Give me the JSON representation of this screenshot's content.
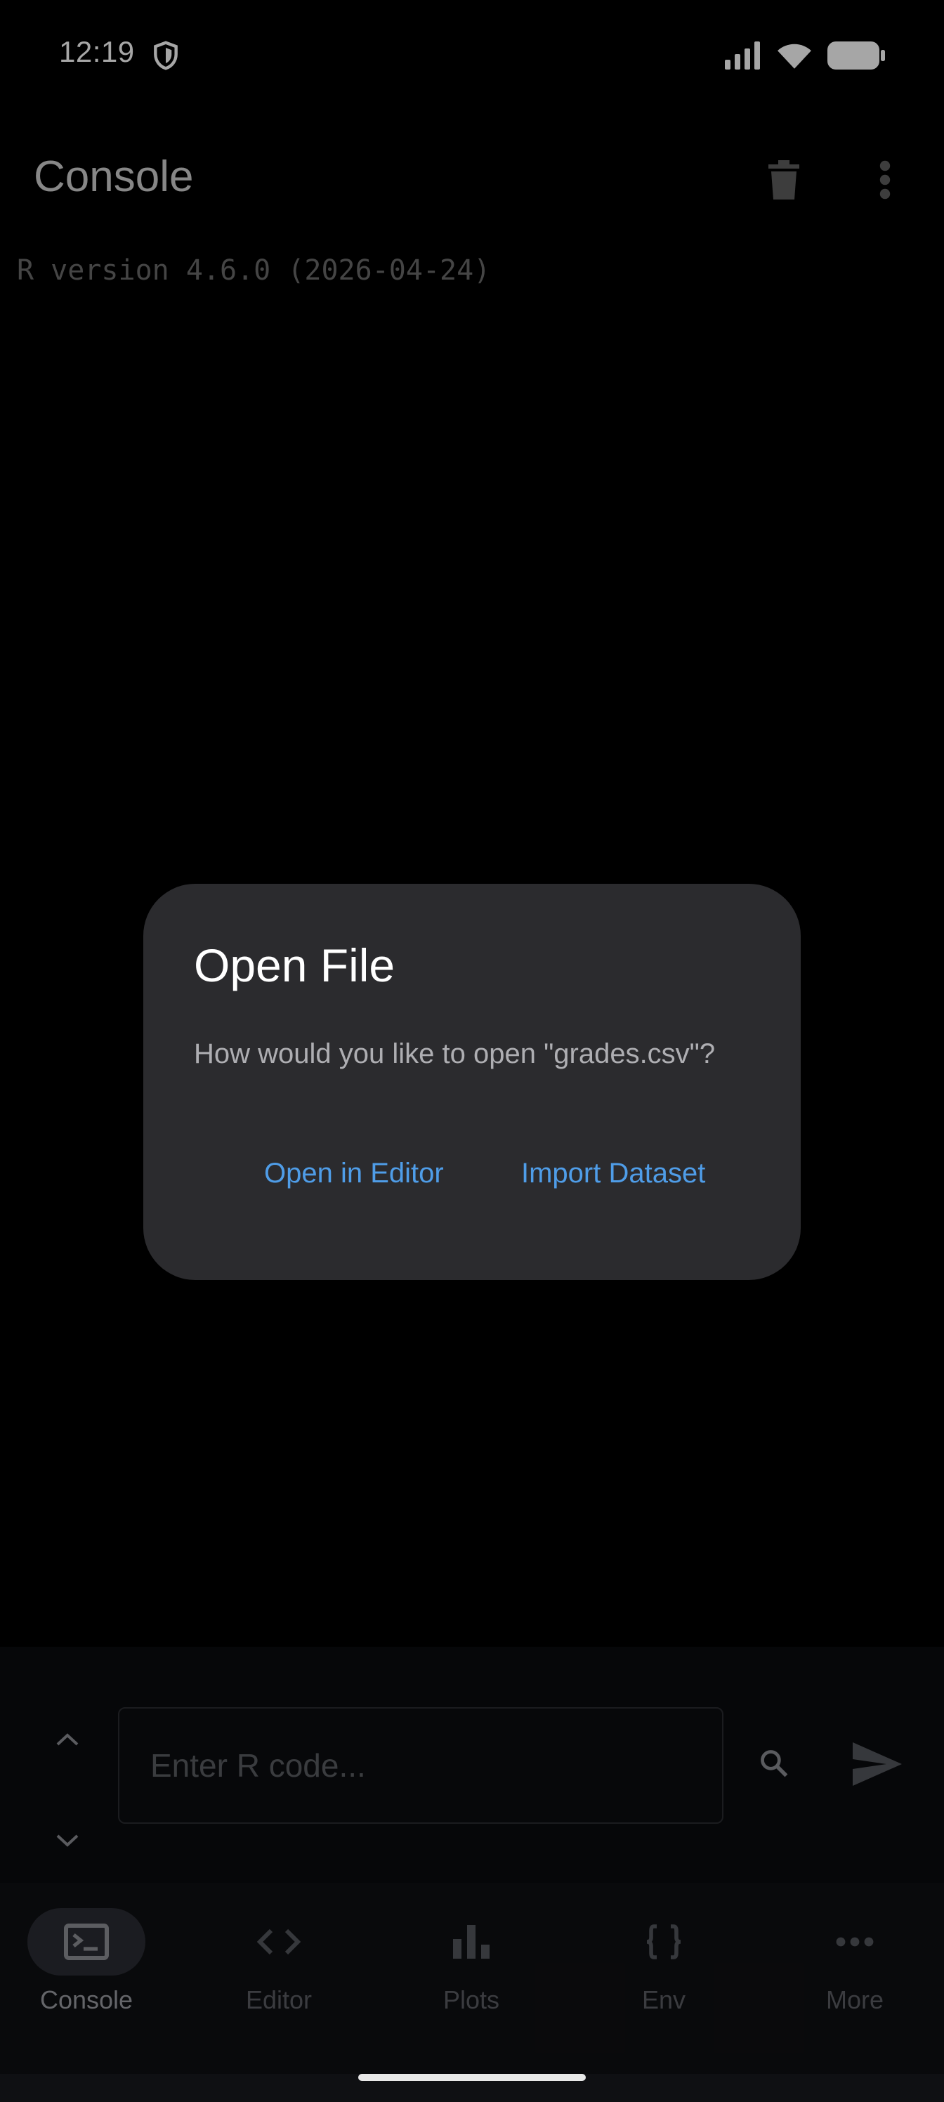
{
  "status_bar": {
    "time": "12:19"
  },
  "app_bar": {
    "title": "Console"
  },
  "console": {
    "lines": [
      "R version 4.6.0 (2026-04-24)"
    ]
  },
  "input": {
    "placeholder": "Enter R code...",
    "value": ""
  },
  "nav": {
    "items": [
      {
        "label": "Console",
        "icon": "terminal-icon",
        "active": true
      },
      {
        "label": "Editor",
        "icon": "code-icon",
        "active": false
      },
      {
        "label": "Plots",
        "icon": "bar-chart-icon",
        "active": false
      },
      {
        "label": "Env",
        "icon": "braces-icon",
        "active": false
      },
      {
        "label": "More",
        "icon": "more-horiz-icon",
        "active": false
      }
    ]
  },
  "dialog": {
    "title": "Open File",
    "message": "How would you like to open \"grades.csv\"?",
    "open_in_editor_label": "Open in Editor",
    "import_dataset_label": "Import Dataset"
  },
  "colors": {
    "background": "#000000",
    "dialog_bg": "#2b2b2e",
    "accent": "#4f9de8",
    "nav_active_pill": "#2a2b33"
  }
}
